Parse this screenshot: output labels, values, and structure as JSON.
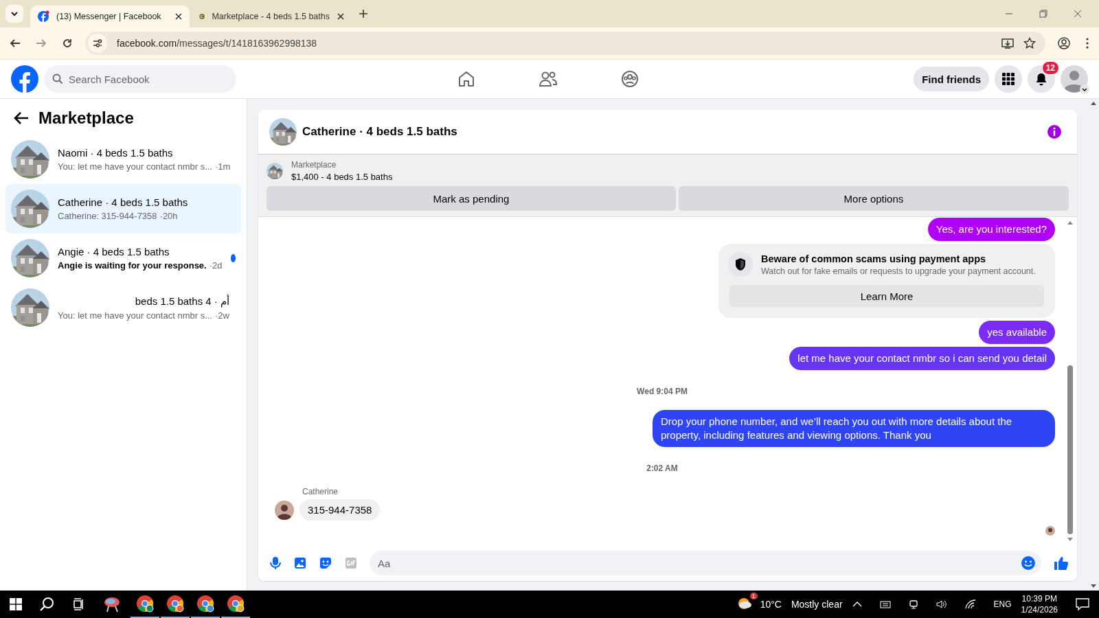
{
  "browser": {
    "tabs": [
      {
        "title": "(13) Messenger | Facebook",
        "selected": true
      },
      {
        "title": "Marketplace - 4 beds 1.5 baths",
        "selected": false
      }
    ],
    "url_host": "facebook.com",
    "url_path": "/messages/t/1418163962998138"
  },
  "header": {
    "search_placeholder": "Search Facebook",
    "find_friends": "Find friends",
    "notification_count": "12"
  },
  "sidebar": {
    "title": "Marketplace",
    "conversations": [
      {
        "name": "Naomi · 4 beds 1.5 baths",
        "preview": "You: let me have your contact nmbr s...",
        "time": "·1m",
        "selected": false,
        "unread": false
      },
      {
        "name": "Catherine · 4 beds 1.5 baths",
        "preview": "Catherine: 315-944-7358",
        "time": "·20h",
        "selected": true,
        "unread": false
      },
      {
        "name": "Angie · 4 beds 1.5 baths",
        "preview": "Angie is waiting for your response.",
        "time": "·2d",
        "selected": false,
        "unread": true
      },
      {
        "name": "أم · 4 beds 1.5 baths",
        "preview": "You: let me have your contact nmbr s...",
        "time": "·2w",
        "selected": false,
        "unread": false
      }
    ]
  },
  "chat": {
    "title": "Catherine · 4 beds 1.5 baths",
    "listing": {
      "label": "Marketplace",
      "title": "$1,400 - 4 beds 1.5 baths"
    },
    "actions": [
      "Mark as pending",
      "More options"
    ],
    "messages": [
      {
        "kind": "outgoing",
        "text": "Yes, are you interested?",
        "color": "#b000f5"
      },
      {
        "kind": "notice",
        "title": "Beware of common scams using payment apps",
        "text": "Watch out for fake emails or requests to upgrade your payment account.",
        "button": "Learn More"
      },
      {
        "kind": "outgoing",
        "text": "yes available",
        "color": "#7a2cf5"
      },
      {
        "kind": "outgoing",
        "text": "let me have your contact nmbr so i can send you detail",
        "color": "#6634f5"
      },
      {
        "kind": "timestamp",
        "text": "Wed 9:04 PM"
      },
      {
        "kind": "outgoing",
        "text": "Drop your phone number, and we’ll reach you out with more details about the property, including features and viewing options.  Thank you",
        "color": "#2f45f5"
      },
      {
        "kind": "timestamp",
        "text": "2:02 AM"
      },
      {
        "kind": "incoming",
        "sender": "Catherine",
        "text": "315-944-7358"
      }
    ],
    "composer_placeholder": "Aa"
  },
  "taskbar": {
    "weather_badge": "1",
    "temperature": "10°C",
    "condition": "Mostly clear",
    "language": "ENG",
    "time": "10:39 PM",
    "date": "1/24/2026"
  }
}
